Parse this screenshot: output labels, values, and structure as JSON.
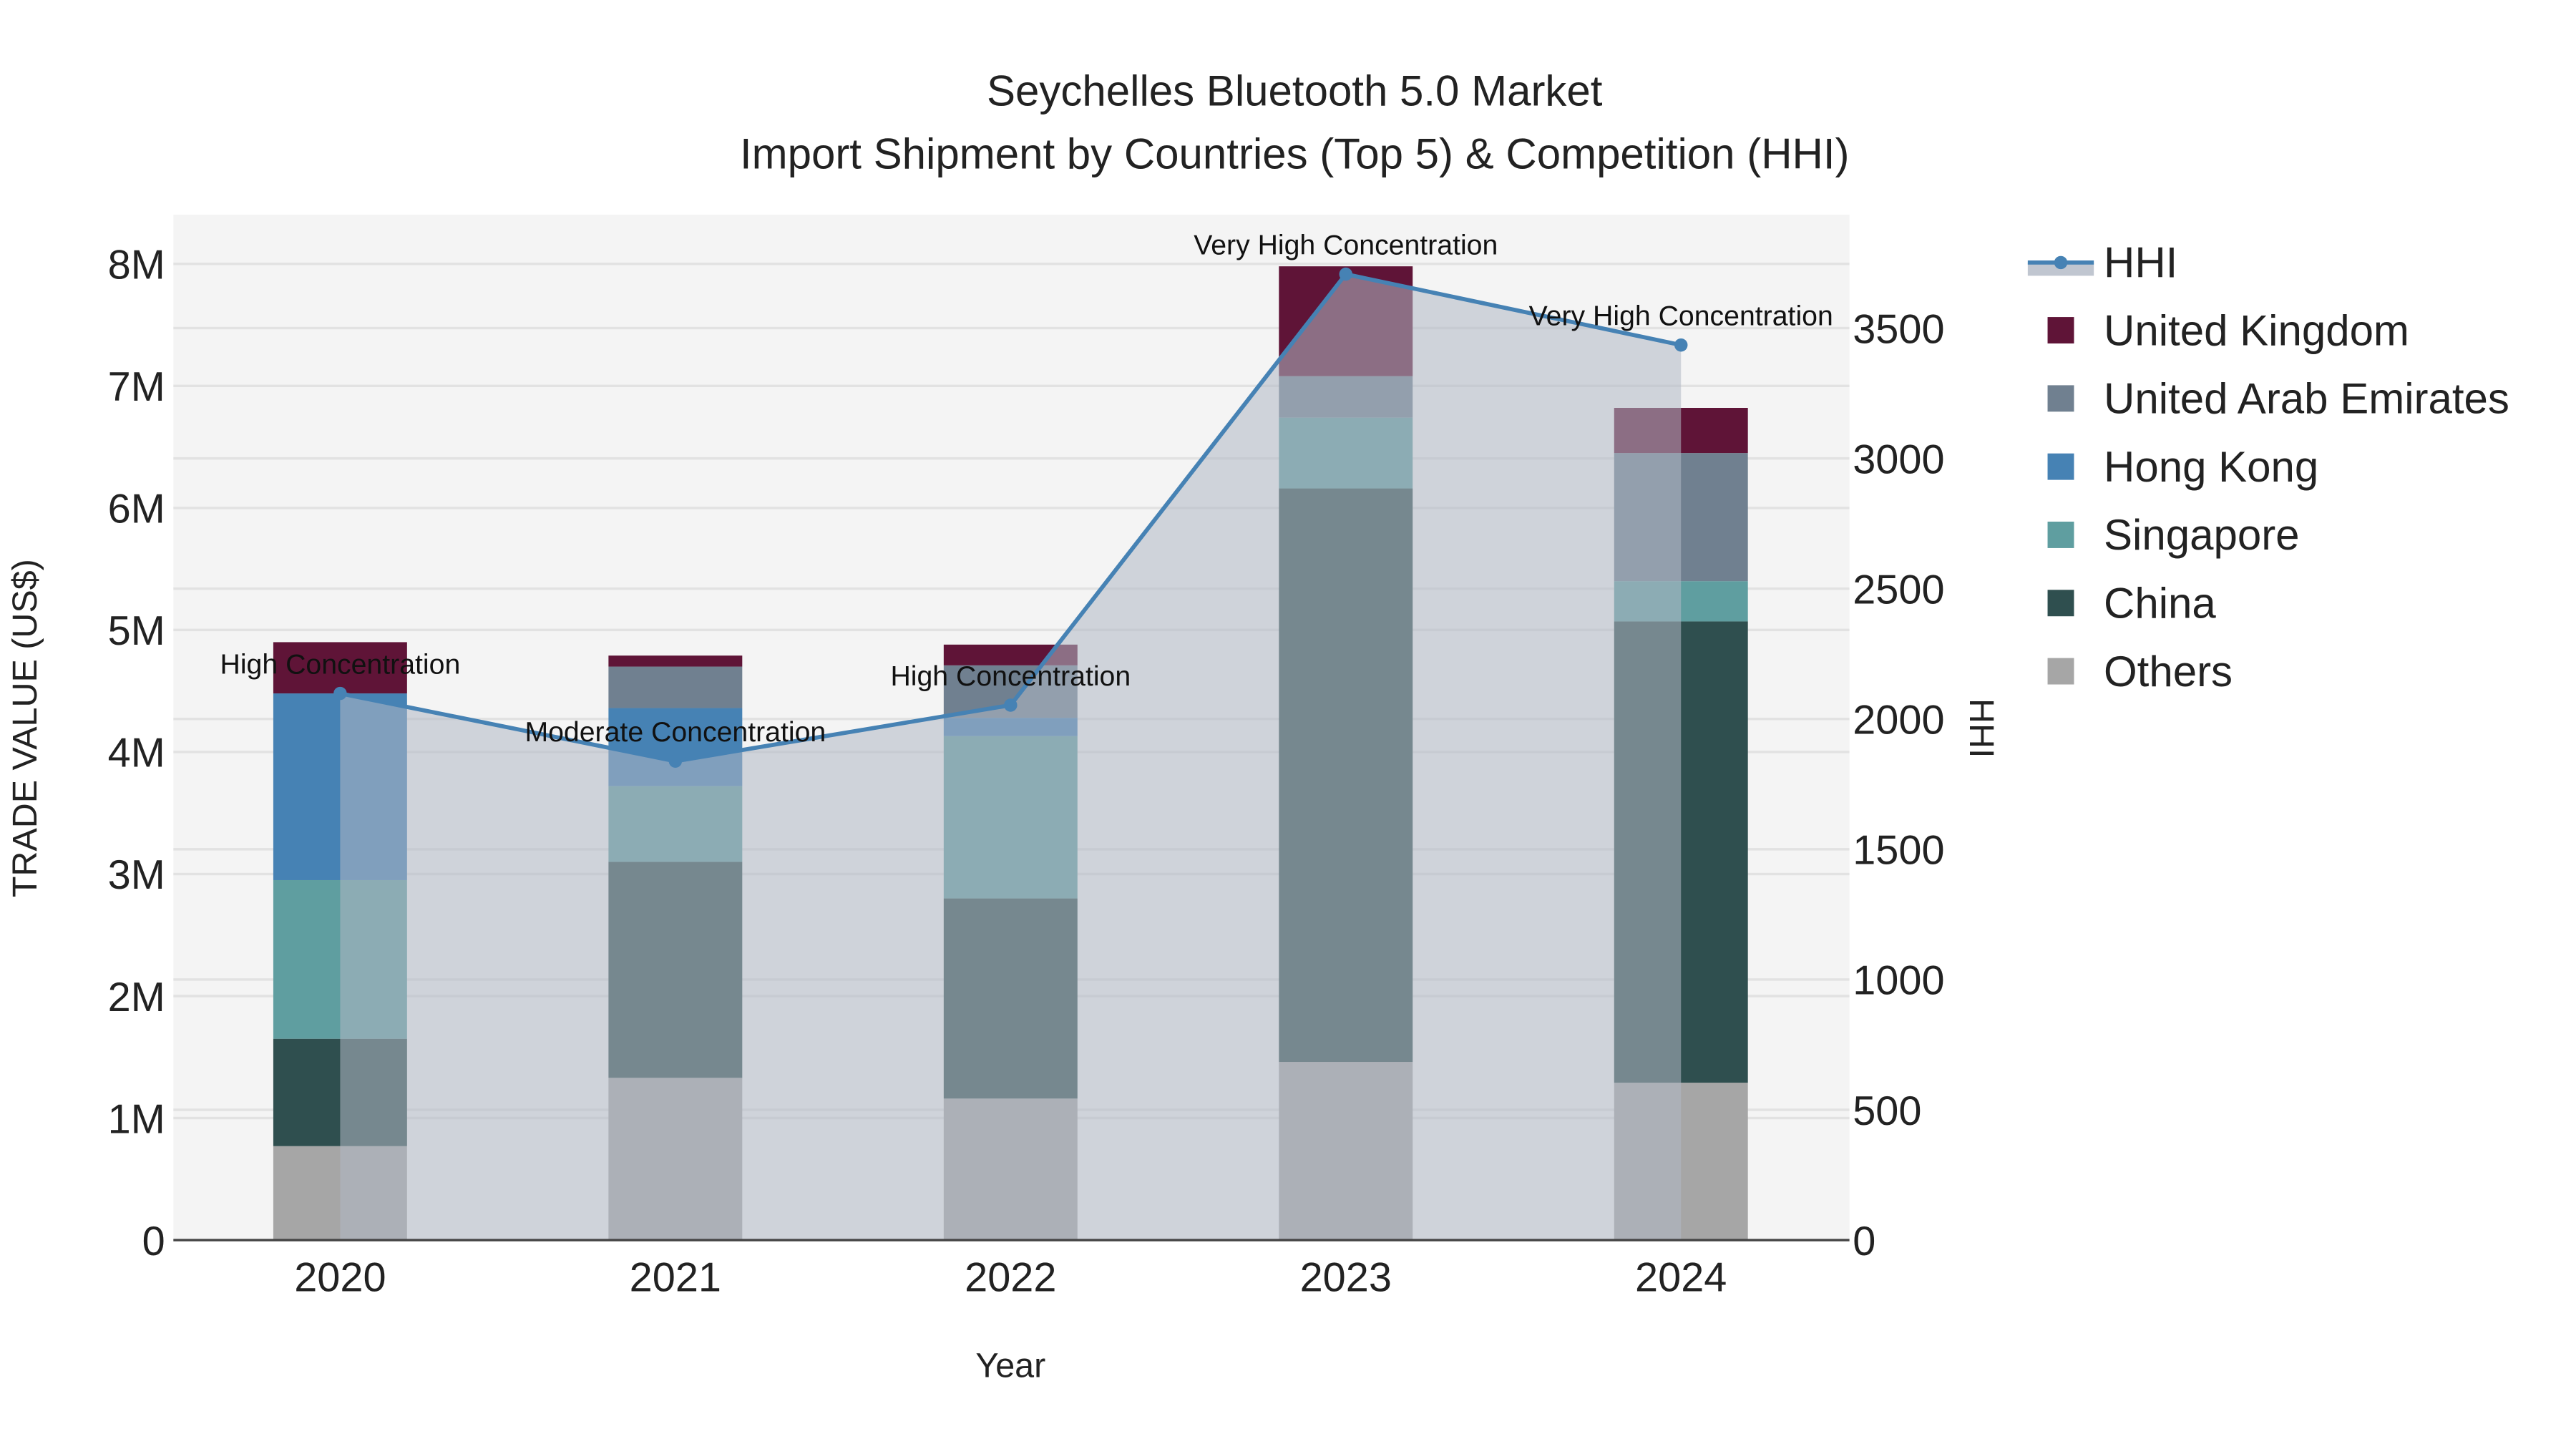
{
  "chart_data": {
    "type": "bar",
    "stacked": true,
    "title": "Seychelles Bluetooth 5.0 Market",
    "subtitle": "Import Shipment by Countries (Top 5) & Competition (HHI)",
    "xlabel": "Year",
    "ylabel": "TRADE VALUE (US$)",
    "y2label": "HHI",
    "categories": [
      "2020",
      "2021",
      "2022",
      "2023",
      "2024"
    ],
    "ylim": [
      0,
      8400000
    ],
    "y2lim": [
      0,
      3900
    ],
    "yticks": [
      0,
      1000000,
      2000000,
      3000000,
      4000000,
      5000000,
      6000000,
      7000000,
      8000000
    ],
    "ytick_labels": [
      "0",
      "1M",
      "2M",
      "3M",
      "4M",
      "5M",
      "6M",
      "7M",
      "8M"
    ],
    "y2ticks": [
      0,
      500,
      1000,
      1500,
      2000,
      2500,
      3000,
      3500
    ],
    "y2tick_labels": [
      "0",
      "500",
      "1000",
      "1500",
      "2000",
      "2500",
      "3000",
      "3500"
    ],
    "grid": true,
    "legend_position": "right",
    "series": [
      {
        "name": "Others",
        "color": "#a6a6a6",
        "values": [
          770000,
          1330000,
          1160000,
          1460000,
          1290000
        ]
      },
      {
        "name": "China",
        "color": "#2f4f4f",
        "values": [
          880000,
          1770000,
          1640000,
          4700000,
          3780000
        ]
      },
      {
        "name": "Singapore",
        "color": "#5f9ea0",
        "values": [
          1300000,
          620000,
          1330000,
          580000,
          330000
        ]
      },
      {
        "name": "Hong Kong",
        "color": "#4682b4",
        "values": [
          1530000,
          640000,
          150000,
          0,
          0
        ]
      },
      {
        "name": "United Arab Emirates",
        "color": "#708090",
        "values": [
          0,
          340000,
          430000,
          340000,
          1050000
        ]
      },
      {
        "name": "United Kingdom",
        "color": "#5f1437",
        "values": [
          420000,
          90000,
          170000,
          900000,
          370000
        ]
      }
    ],
    "hhi": {
      "name": "HHI",
      "color": "#4682b4",
      "values": [
        2098,
        1838,
        2053,
        3707,
        3435
      ],
      "annotations": [
        "High Concentration",
        "Moderate Concentration",
        "High Concentration",
        "Very High Concentration",
        "Very High Concentration"
      ]
    }
  }
}
